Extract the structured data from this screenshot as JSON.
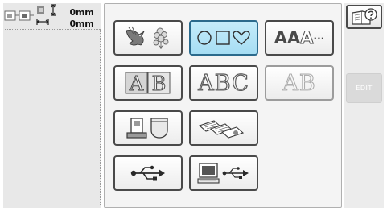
{
  "left_panel": {
    "width_value": "0",
    "width_unit": "mm",
    "height_value": "0",
    "height_unit": "mm"
  },
  "main_panel": {
    "rows": [
      [
        "pattern-bird-flower",
        "frame-shapes",
        "monogram-aaa"
      ],
      [
        "letters-ab-framed",
        "letters-abc",
        "letters-ab-faint"
      ],
      [
        "machine-pocket",
        "memory-cards"
      ],
      [
        "usb",
        "computer-usb"
      ]
    ],
    "selected": "frame-shapes",
    "buttons": {
      "abc_label": "ABC",
      "ab_label": "AB",
      "ab_framed_label": "AB",
      "aaa_label": "AA",
      "aaa_outline_label": "A",
      "aaa_dash": "···"
    }
  },
  "right_panel": {
    "edit_label": "EDIT",
    "edit_enabled": false
  },
  "colors": {
    "selected_bg": "#a6ddf3",
    "button_border": "#4a4a4a"
  }
}
